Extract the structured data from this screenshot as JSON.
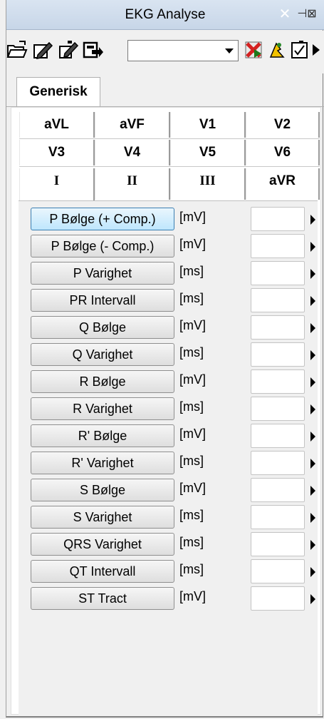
{
  "window": {
    "title": "EKG Analyse",
    "close_glyph": "✕",
    "pin_glyph": "⊣⊠"
  },
  "toolbar": {
    "icons": [
      "open-folder-icon",
      "edit-icon",
      "copy-icon",
      "export-icon",
      "no-entry-icon",
      "run-icon",
      "checkbox-icon",
      "more-arrow-icon"
    ],
    "combo_value": ""
  },
  "outer_tab": {
    "label": "Generisk"
  },
  "lead_tabs": {
    "row1": [
      "aVL",
      "aVF",
      "V1",
      "V2"
    ],
    "row2": [
      "V3",
      "V4",
      "V5",
      "V6"
    ],
    "row3": [
      "I",
      "II",
      "III",
      "aVR"
    ],
    "selected": "I"
  },
  "params": [
    {
      "label": "P Bølge (+ Comp.)",
      "unit": "[mV]",
      "value": ""
    },
    {
      "label": "P Bølge (- Comp.)",
      "unit": "[mV]",
      "value": ""
    },
    {
      "label": "P Varighet",
      "unit": "[ms]",
      "value": ""
    },
    {
      "label": "PR Intervall",
      "unit": "[ms]",
      "value": ""
    },
    {
      "label": "Q Bølge",
      "unit": "[mV]",
      "value": ""
    },
    {
      "label": "Q Varighet",
      "unit": "[ms]",
      "value": ""
    },
    {
      "label": "R Bølge",
      "unit": "[mV]",
      "value": ""
    },
    {
      "label": "R Varighet",
      "unit": "[ms]",
      "value": ""
    },
    {
      "label": "R' Bølge",
      "unit": "[mV]",
      "value": ""
    },
    {
      "label": "R' Varighet",
      "unit": "[ms]",
      "value": ""
    },
    {
      "label": "S Bølge",
      "unit": "[mV]",
      "value": ""
    },
    {
      "label": "S Varighet",
      "unit": "[ms]",
      "value": ""
    },
    {
      "label": "QRS Varighet",
      "unit": "[ms]",
      "value": ""
    },
    {
      "label": "QT Intervall",
      "unit": "[ms]",
      "value": ""
    },
    {
      "label": "ST Tract",
      "unit": "[mV]",
      "value": ""
    }
  ],
  "colors": {
    "title_bar": "#c7d6e8",
    "active_button": "#bee6fd",
    "no_entry_red": "#d42020",
    "run_yellow": "#f2c200"
  }
}
